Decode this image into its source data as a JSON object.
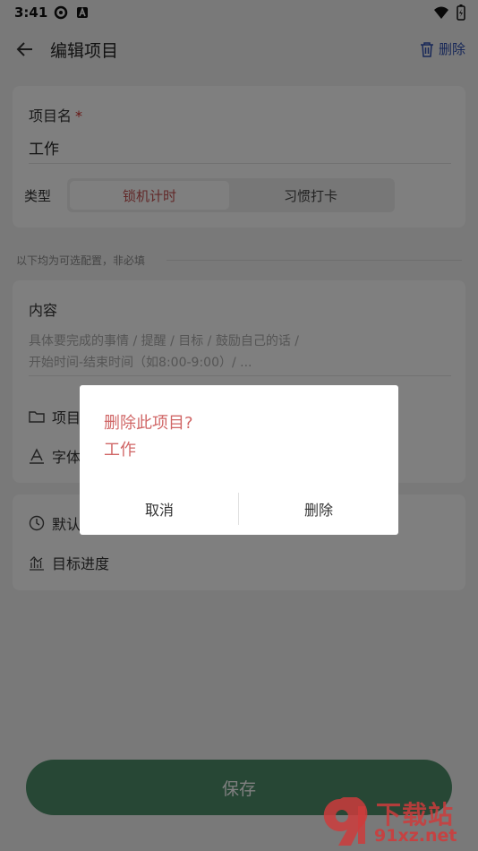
{
  "status_bar": {
    "time": "3:41"
  },
  "app_bar": {
    "title": "编辑项目",
    "delete_label": "删除"
  },
  "form": {
    "name_label": "项目名",
    "required_mark": "*",
    "name_value": "工作",
    "type_label": "类型",
    "type_options": [
      "锁机计时",
      "习惯打卡"
    ],
    "type_selected": "锁机计时",
    "optional_hint": "以下均为可选配置，非必填",
    "content_label": "内容",
    "content_placeholder_line1": "具体要完成的事情 / 提醒 / 目标 / 鼓励自己的话 /",
    "content_placeholder_line2": "开始时间-结束时间（如8:00-9:00）/ ...",
    "folder_label": "项目",
    "font_label": "字体",
    "default_label": "默认",
    "progress_label": "目标进度",
    "save_label": "保存"
  },
  "dialog": {
    "title": "删除此项目?",
    "subtitle": "工作",
    "cancel_label": "取消",
    "confirm_label": "删除"
  },
  "watermark": {
    "text": "下载站",
    "url": "91xz.net"
  },
  "colors": {
    "accent_green": "#4f8f6b",
    "selected_red": "#c45050",
    "dialog_text": "#d06666",
    "delete_blue": "#2f4fb0"
  }
}
